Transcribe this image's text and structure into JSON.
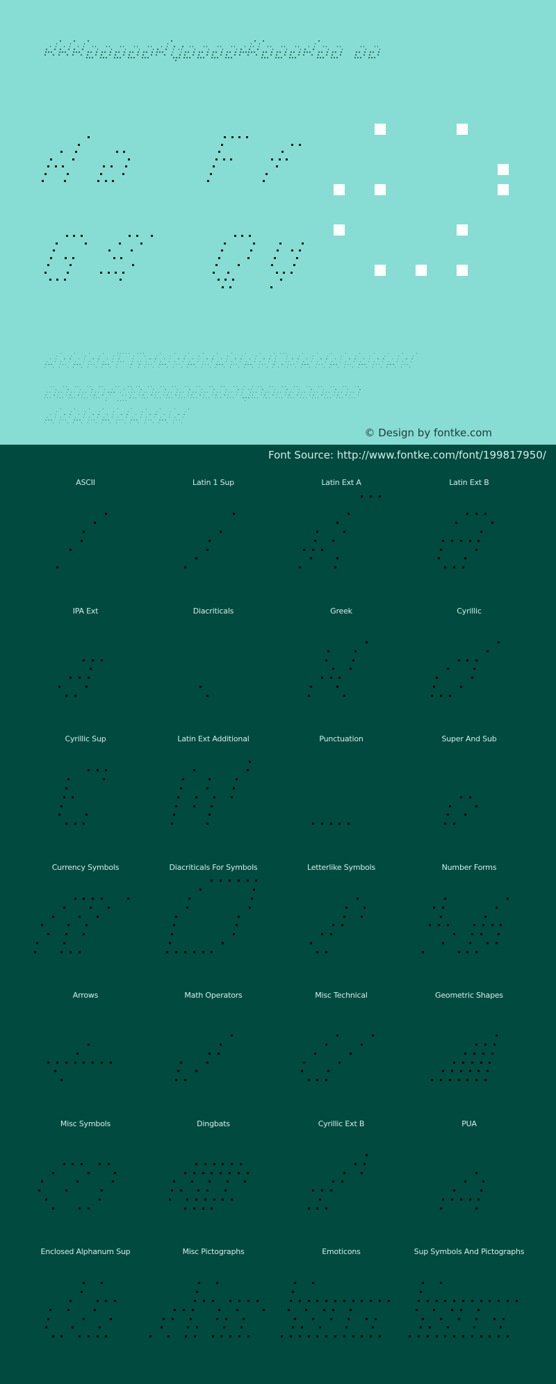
{
  "preview": {
    "title": "DRKrapkaSquare-ThinObl",
    "title_suffix": "ab",
    "sample_pairs": [
      "Aa",
      "Ff",
      "Gg",
      "Qq"
    ],
    "big_glyph": "a",
    "uppercase": "ABCDEFGHIJKLMNOPQRSTUVWXYZ",
    "lowercase": "abcdefghijklmnopqrstuvwxyz",
    "digits": "0123456789",
    "credit": "© Design by fontke.com",
    "background_color": "#87ddd3",
    "dot_color": "#0b1d19",
    "big_glyph_color": "#ffffff"
  },
  "source": {
    "text": "Font Source: http://www.fontke.com/font/199817950/"
  },
  "bottom_background_color": "#004a40",
  "glyphs": {
    "A": [
      "....#",
      "...#.",
      ".#.#.",
      "#..#.",
      "###..",
      "#..#.",
      "#..#."
    ],
    "a": [
      ".##.",
      "...#",
      "##.#",
      "#..#",
      "###."
    ],
    "F": [
      "####",
      "#...",
      "#...",
      "###.",
      "#...",
      "#...",
      "#..."
    ],
    "f": [
      "..##",
      ".#..",
      "###.",
      ".#..",
      "#...",
      "#..."
    ],
    "G": [
      ".###.",
      "#...#",
      "#....",
      "#.##.",
      "#..#.",
      "#..#.",
      ".###."
    ],
    "g": [
      "..##.#",
      ".#..#.",
      "#..#..",
      ".##...",
      "....#.",
      "####..",
      "...#.."
    ],
    "Q": [
      ".###.",
      "#...#",
      "#...#",
      "#...#",
      "#..#.",
      "#.#..",
      ".###.",
      "..##."
    ],
    "q": [
      "#..#",
      "#.##",
      "#..#",
      "#..#",
      ".###",
      "..#.",
      ".#.."
    ],
    "big_a": [
      ".#.#.",
      ".....",
      "....#",
      "##..#",
      ".....",
      "#..#.",
      ".....",
      ".###."
    ]
  },
  "blocks": [
    {
      "label": "ASCII",
      "glyph": [
        "....#",
        "...#.",
        "..#..",
        "..#..",
        ".#...",
        ".....",
        "#...."
      ]
    },
    {
      "label": "Latin 1 Sup",
      "glyph": [
        "....#",
        ".....",
        "...#.",
        "..#..",
        "..#..",
        ".#...",
        "#...."
      ]
    },
    {
      "label": "Latin Ext A",
      "glyph": [
        ".....###",
        "........",
        "....#...",
        "...#....",
        ".#..#...",
        ".#.#....",
        "###.....",
        ".#..#...",
        "#...#..."
      ]
    },
    {
      "label": "Latin Ext B",
      "glyph": [
        "..###.",
        ".#...#",
        "....#.",
        "#####.",
        "#...#.",
        "#..#..",
        ".###.."
      ]
    },
    {
      "label": "IPA Ext",
      "glyph": [
        "..###",
        "...#.",
        ".###.",
        "#..#.",
        ".##.."
      ]
    },
    {
      "label": "Diacriticals",
      "glyph": [
        "#.",
        ".#"
      ]
    },
    {
      "label": "Greek",
      "glyph": [
        ".....#",
        ".#..#.",
        ".#..#.",
        "..#.#.",
        ".###..",
        "#..#..",
        "#...#."
      ]
    },
    {
      "label": "Cyrillic",
      "glyph": [
        "......#",
        ".....#.",
        "..###..",
        ".#..#..",
        "#...#..",
        "#..#...",
        "###...."
      ]
    },
    {
      "label": "Cyrillic Sup",
      "glyph": [
        "..###",
        "#...#",
        "#....",
        "##...",
        "#....",
        "#..#.",
        ".###."
      ]
    },
    {
      "label": "Latin Ext Additional",
      "glyph": [
        ".......#",
        ".#.....#",
        "#..#..#.",
        "#..#..#.",
        "#.#.#.#.",
        "#.#.#...",
        "#...#...",
        "#...#..."
      ]
    },
    {
      "label": "Punctuation",
      "glyph": [
        "#####"
      ]
    },
    {
      "label": "Super And Sub",
      "glyph": [
        ".##",
        "#..#",
        "#.#.",
        "##.."
      ]
    },
    {
      "label": "Currency Symbols",
      "glyph": [
        "...####..#",
        "..#..#.#..",
        ".#..#.#...",
        "#..#.#....",
        ".#.#.#....",
        "#..#......",
        "#..###...."
      ]
    },
    {
      "label": "Diacriticals For Symbols",
      "glyph": [
        "...######",
        "..#.....#",
        ".#......#",
        ".#......#",
        "#......#.",
        "#......#.",
        "#......#.",
        "#.....#..",
        "######..."
      ]
    },
    {
      "label": "Letterlike Symbols",
      "glyph": [
        "....#",
        "...#.#",
        "...#.#",
        "..##..",
        ".##...",
        "#.....",
        ".##..."
      ]
    },
    {
      "label": "Number Forms",
      "glyph": [
        ".#......#",
        "##.....#",
        ".#....#..",
        "###..####",
        "...#.##.#",
        "..#..#.##",
        "#...###.."
      ]
    },
    {
      "label": "Arrows",
      "glyph": [
        "....#...",
        "...#....",
        "########",
        ".#......",
        "..#....."
      ]
    },
    {
      "label": "Math Operators",
      "glyph": [
        ".....#",
        "....#..",
        "...##..",
        "#..#...",
        "#.#....",
        "##....."
      ]
    },
    {
      "label": "Misc Technical",
      "glyph": [
        "...#...#",
        "..#...#.",
        ".#...#..",
        "#...#...",
        "#..#....",
        ".###...."
      ]
    },
    {
      "label": "Geometric Shapes",
      "glyph": [
        "......#",
        "....###",
        "...####",
        "..#####",
        ".######",
        "#######"
      ]
    },
    {
      "label": "Misc Symbols",
      "glyph": [
        "..###.##",
        ".#...#..#",
        "#...#...#",
        "#..#...#.",
        ".#.....#.",
        "..#..##..."
      ]
    },
    {
      "label": "Dingbats",
      "glyph": [
        "..######",
        ".########",
        "#.#.#.#.#",
        "##.##.#..",
        "#.######.",
        "..####..."
      ]
    },
    {
      "label": "Cyrillic Ext B",
      "glyph": [
        ".....#",
        "....##",
        "...#.#",
        "..##..",
        "###...",
        ".#....",
        "###..."
      ]
    },
    {
      "label": "PUA",
      "glyph": [
        "...#",
        "..#.#",
        ".#..#",
        "#####",
        "#...#"
      ]
    },
    {
      "label": "Enclosed Alphanum Sup",
      "glyph": [
        "...#.#",
        "...#..",
        "..#..###",
        "#.#..#..",
        "#...#..#",
        "#..#..#.",
        ".##.####"
      ]
    },
    {
      "label": "Misc Pictographs",
      "glyph": [
        "....#.#",
        "....#..",
        "....###.####",
        "..###..#.#..#",
        ".##.#..##.#..",
        ".#..##..#.#.",
        "#.#.##.#####"
      ]
    },
    {
      "label": "Emoticons",
      "glyph": [
        "#.#",
        "#..",
        "############",
        "#.#.##.#....",
        ".#.#.#.#.##.",
        ".##.#..#..#.",
        "############"
      ]
    },
    {
      "label": "Sup Symbols And Pictographs",
      "glyph": [
        "#.#",
        "#..",
        "############",
        "#.#.##.#....",
        ".#.#.#.#.##.",
        ".##.#..#..#.",
        "############"
      ]
    }
  ]
}
